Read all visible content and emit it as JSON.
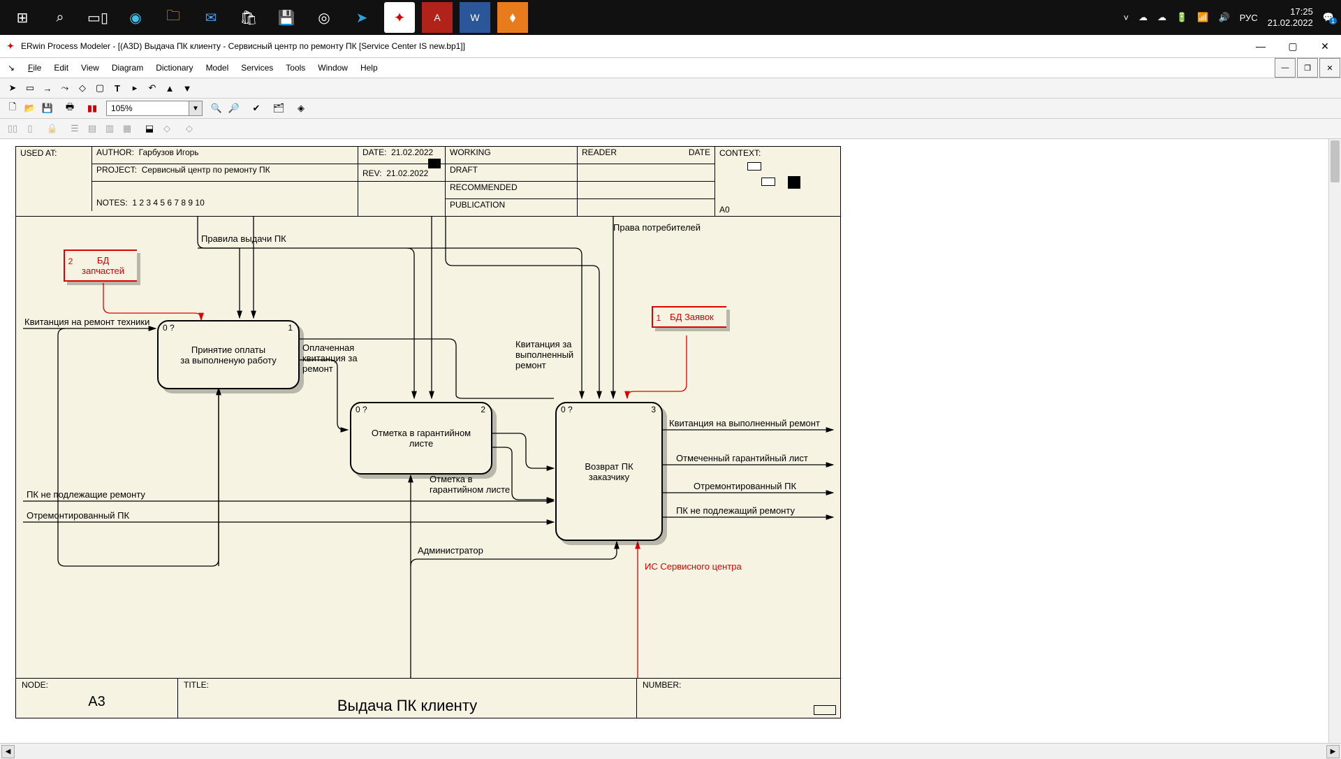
{
  "taskbar": {
    "icons": [
      "start",
      "search",
      "taskview",
      "edge",
      "explorer",
      "mail",
      "store",
      "snip",
      "chrome",
      "telegram",
      "erwin",
      "acrobat",
      "word",
      "draw"
    ],
    "right": {
      "lang": "РУС",
      "time": "17:25",
      "date": "21.02.2022",
      "notif": "1"
    }
  },
  "title": "ERwin Process Modeler - [(A3D) Выдача ПК клиенту  - Сервисный центр по ремонту ПК  [Service Center IS new.bp1]]",
  "menu": {
    "file": "File",
    "edit": "Edit",
    "view": "View",
    "diagram": "Diagram",
    "dictionary": "Dictionary",
    "model": "Model",
    "services": "Services",
    "tools": "Tools",
    "window": "Window",
    "help": "Help"
  },
  "zoom": "105%",
  "sheet": {
    "used_at": "USED AT:",
    "author_lbl": "AUTHOR:",
    "author": "Гарбузов Игорь",
    "project_lbl": "PROJECT:",
    "project": "Сервисный центр по ремонту ПК",
    "notes_lbl": "NOTES:",
    "notes": "1  2  3  4  5  6  7  8  9  10",
    "date_lbl": "DATE:",
    "date": "21.02.2022",
    "rev_lbl": "REV:",
    "rev": "21.02.2022",
    "working": "WORKING",
    "draft": "DRAFT",
    "recommended": "RECOMMENDED",
    "publication": "PUBLICATION",
    "reader": "READER",
    "reader_date": "DATE",
    "context": "CONTEXT:",
    "context_code": "A0",
    "node_lbl": "NODE:",
    "node": "A3",
    "title_lbl": "TITLE:",
    "title": "Выдача ПК клиенту",
    "number_lbl": "NUMBER:"
  },
  "activities": {
    "a1": {
      "ico": "0 ?",
      "num": "1",
      "label": "Принятие оплаты\nза выполненую работу"
    },
    "a2": {
      "ico": "0 ?",
      "num": "2",
      "label": "Отметка в гарантийном листе"
    },
    "a3": {
      "ico": "0 ?",
      "num": "3",
      "label": "Возврат ПК заказчику"
    }
  },
  "datastores": {
    "d1": {
      "num": "2",
      "label": "БД\nзапчастей"
    },
    "d2": {
      "num": "1",
      "label": "БД Заявок"
    }
  },
  "labels": {
    "rules": "Правила выдачи ПК",
    "rights": "Права потребителей",
    "receipt_in": "Квитанция на ремонт техники",
    "paid": "Оплаченная\nквитанция за\nремонт",
    "receipt_done": "Квитанция за\nвыполненный\nремонт",
    "mark": "Отметка в\nгарантийном листе",
    "pk_no": "ПК не подлежащие ремонту",
    "pk_fixed": "Отремонтированный ПК",
    "admin": "Администратор",
    "is_sc": "ИС Сервисного центра",
    "out1": "Квитанция на выполненный ремонт",
    "out2": "Отмеченный гарантийный лист",
    "out3": "Отремонтированный ПК",
    "out4": "ПК не подлежащий ремонту"
  }
}
